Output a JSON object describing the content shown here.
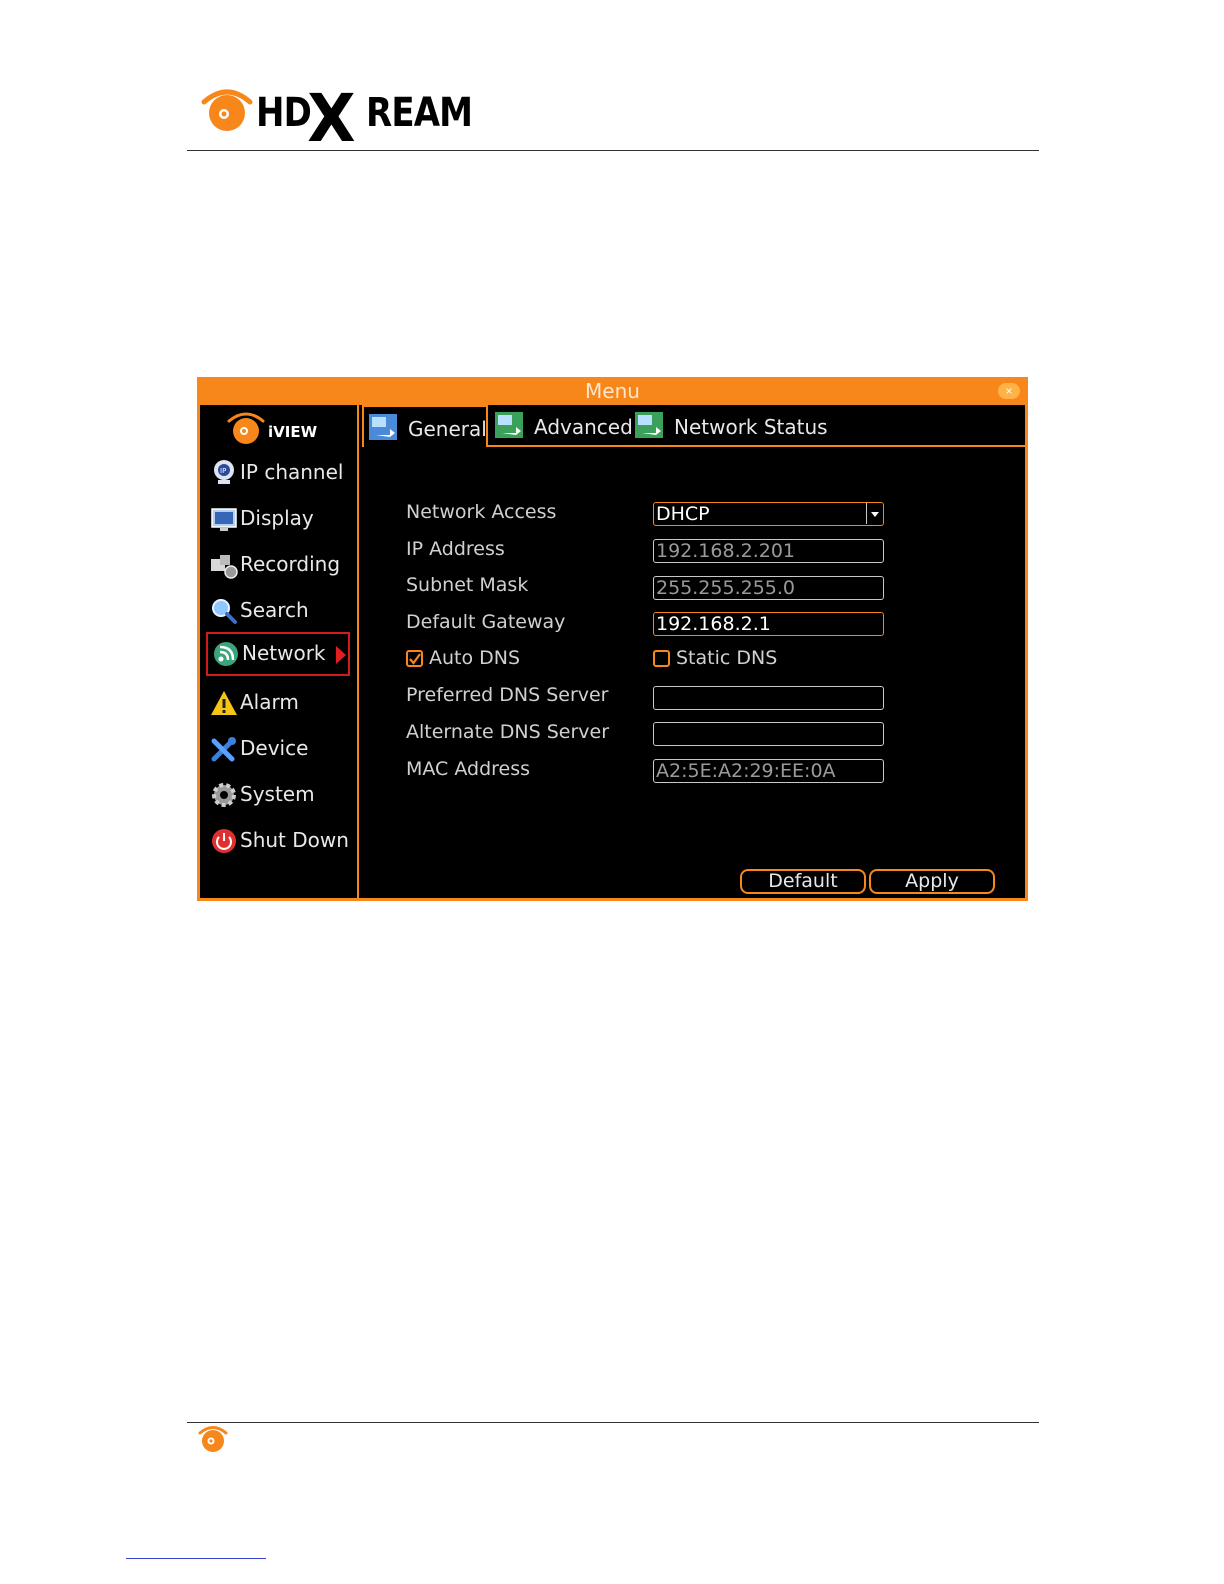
{
  "header": {
    "logo_hd": "HD",
    "logo_x": "X",
    "logo_ream": "REAM"
  },
  "window": {
    "title": "Menu",
    "close_glyph": "×"
  },
  "sidebar": {
    "brand": "iVIEW",
    "items": [
      {
        "label": "IP channel",
        "icon": "ip-camera-icon"
      },
      {
        "label": "Display",
        "icon": "monitor-icon"
      },
      {
        "label": "Recording",
        "icon": "recording-icon"
      },
      {
        "label": "Search",
        "icon": "magnifier-icon"
      },
      {
        "label": "Network",
        "icon": "network-icon",
        "active": true
      },
      {
        "label": "Alarm",
        "icon": "warning-icon"
      },
      {
        "label": "Device",
        "icon": "tools-icon"
      },
      {
        "label": "System",
        "icon": "gear-icon"
      },
      {
        "label": "Shut Down",
        "icon": "power-icon"
      }
    ]
  },
  "tabs": [
    {
      "label": "General",
      "active": true
    },
    {
      "label": "Advanced"
    },
    {
      "label": "Network Status"
    }
  ],
  "form": {
    "network_access_label": "Network Access",
    "network_access_value": "DHCP",
    "ip_address_label": "IP Address",
    "ip_address_value": "192.168.2.201",
    "subnet_mask_label": "Subnet Mask",
    "subnet_mask_value": "255.255.255.0",
    "gateway_label": "Default Gateway",
    "gateway_value": "192.168.2.1",
    "auto_dns_label": "Auto DNS",
    "auto_dns_checked": true,
    "static_dns_label": "Static DNS",
    "static_dns_checked": false,
    "preferred_dns_label": "Preferred DNS Server",
    "preferred_dns_value": "",
    "alternate_dns_label": "Alternate DNS Server",
    "alternate_dns_value": "",
    "mac_label": "MAC Address",
    "mac_value": "A2:5E:A2:29:EE:0A"
  },
  "buttons": {
    "default_label": "Default",
    "apply_label": "Apply"
  },
  "colors": {
    "accent": "#f7861b",
    "active_border": "#d01c1c",
    "background": "#000000"
  }
}
